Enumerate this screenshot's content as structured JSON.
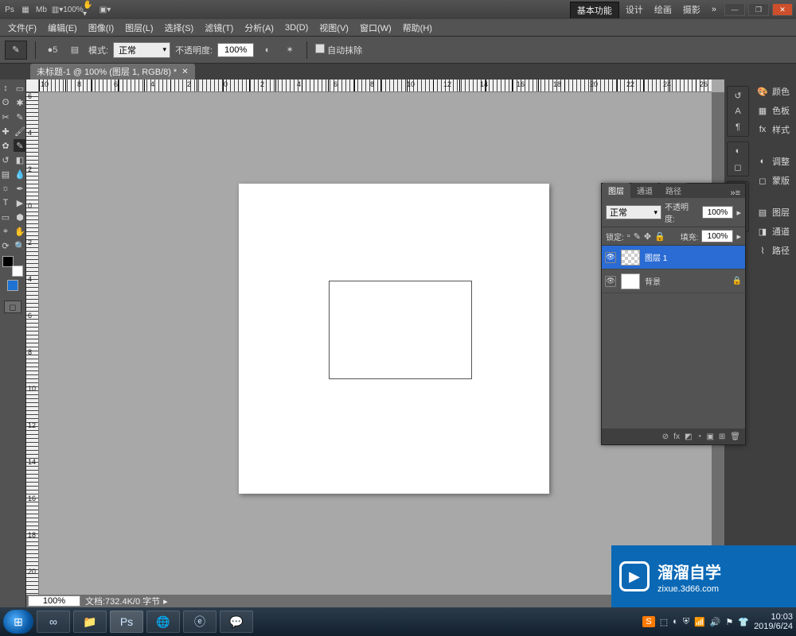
{
  "title_bar": {
    "app_short": "Ps",
    "zoom_display": "100%",
    "workspace_active": "基本功能",
    "workspace_links": [
      "设计",
      "绘画",
      "摄影"
    ],
    "overflow": "»"
  },
  "menu": {
    "items": [
      "文件(F)",
      "编辑(E)",
      "图像(I)",
      "图层(L)",
      "选择(S)",
      "滤镜(T)",
      "分析(A)",
      "3D(D)",
      "视图(V)",
      "窗口(W)",
      "帮助(H)"
    ]
  },
  "options": {
    "brush_size": "5",
    "mode_label": "模式:",
    "mode_value": "正常",
    "opacity_label": "不透明度:",
    "opacity_value": "100%",
    "autoerase_label": "自动抹除"
  },
  "doc_tab": {
    "title": "未标题-1 @ 100% (图层 1, RGB/8) *"
  },
  "ruler": {
    "h_labels": [
      "10",
      "8",
      "6",
      "4",
      "2",
      "0",
      "2",
      "4",
      "6",
      "8",
      "10",
      "12",
      "14",
      "16",
      "18",
      "20",
      "22",
      "24",
      "26"
    ],
    "v_labels": [
      "6",
      "4",
      "2",
      "0",
      "2",
      "4",
      "6",
      "8",
      "10",
      "12",
      "14",
      "16",
      "18",
      "20"
    ]
  },
  "status": {
    "zoom": "100%",
    "docinfo": "文档:732.4K/0 字节"
  },
  "right_panels": {
    "group1": [
      "颜色",
      "色板",
      "样式"
    ],
    "group2": [
      "调整",
      "蒙版"
    ],
    "group3": [
      "图层",
      "通道",
      "路径"
    ]
  },
  "layers_panel": {
    "tabs": [
      "图层",
      "通道",
      "路径"
    ],
    "blend_mode": "正常",
    "opacity_label": "不透明度:",
    "opacity_value": "100%",
    "lock_label": "锁定:",
    "fill_label": "填充:",
    "fill_value": "100%",
    "layers": [
      {
        "name": "图层 1",
        "selected": true,
        "checker": true,
        "locked": false
      },
      {
        "name": "背景",
        "selected": false,
        "checker": false,
        "locked": true
      }
    ],
    "footer_icons": [
      "⊘",
      "fx",
      "◩",
      "◔",
      "▣",
      "⊞",
      "🗑"
    ]
  },
  "watermark": {
    "brand": "溜溜自学",
    "url": "zixue.3d66.com"
  },
  "taskbar": {
    "tray_sogou": "S",
    "clock_time": "10:03",
    "clock_date": "2019/6/24"
  }
}
